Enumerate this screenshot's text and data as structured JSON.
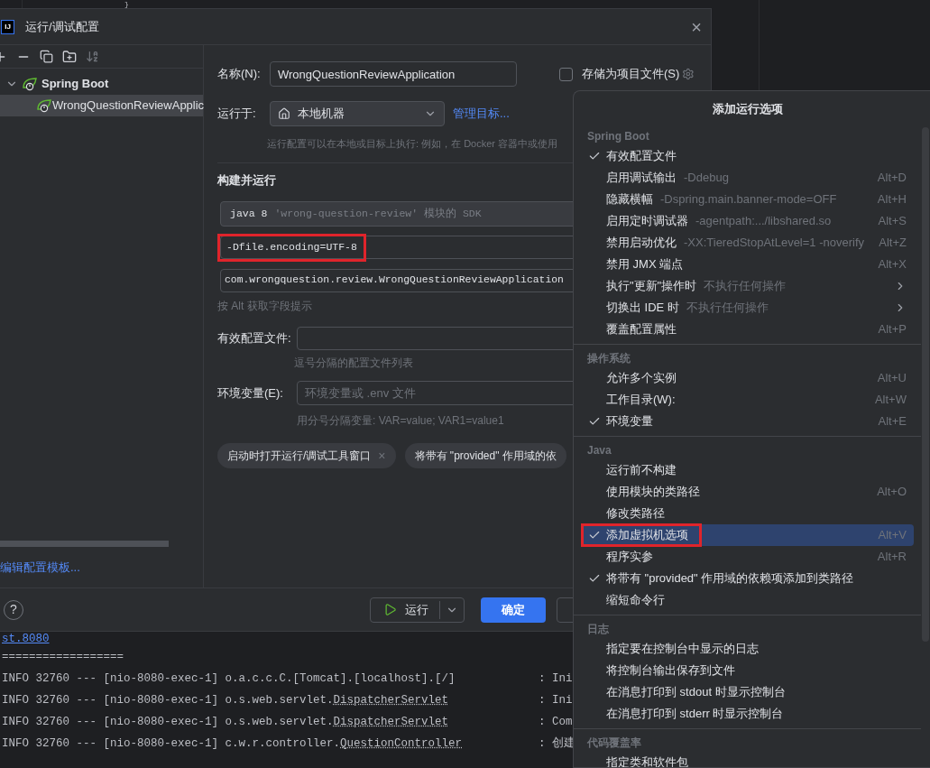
{
  "editor": {
    "brace": "}"
  },
  "dialog": {
    "logo": "IJ",
    "title": "运行/调试配置",
    "close": "×",
    "tree": [
      {
        "label": "Spring Boot",
        "expanded": true,
        "selected": false,
        "children": [
          {
            "label": "WrongQuestionReviewApplic",
            "selected": true
          }
        ]
      }
    ],
    "edit_templates_link": "编辑配置模板...",
    "form": {
      "name_label": "名称(N):",
      "name_value": "WrongQuestionReviewApplication",
      "store_checkbox": {
        "label": "存储为项目文件(S)",
        "checked": false
      },
      "run_on_label": "运行于:",
      "run_on_value": "本地机器",
      "manage_link": "管理目标...",
      "run_on_hint": "运行配置可以在本地或目标上执行: 例如，在 Docker 容器中或使用",
      "section": "构建并运行",
      "sdk": {
        "main": "java 8",
        "detail": "'wrong-question-review' 模块的 SDK"
      },
      "vm_options": {
        "value": "-Dfile.encoding=UTF-8",
        "marked": true
      },
      "main_class": "com.wrongquestion.review.WrongQuestionReviewApplication",
      "alt_hint": "按 Alt 获取字段提示",
      "profiles_label": "有效配置文件:",
      "profiles_hint": "逗号分隔的配置文件列表",
      "env_label": "环境变量(E):",
      "env_placeholder": "环境变量或 .env 文件",
      "env_hint": "用分号分隔变量: VAR=value; VAR1=value1",
      "chips": [
        {
          "label": "启动时打开运行/调试工具窗口",
          "close": "×"
        },
        {
          "label": "将带有 \"provided\" 作用域的依"
        }
      ]
    },
    "footer": {
      "help": "?",
      "run": "运行",
      "ok": "确定"
    }
  },
  "console": {
    "link": "st.8080",
    "rule": "==================",
    "lines": [
      {
        "prefix": "INFO 32760 --- [nio-8080-exec-1] o.a.c.c.C.[Tomcat].[localhost].[/]",
        "message": ": Ini"
      },
      {
        "prefix": "INFO 32760 --- [nio-8080-exec-1] o.s.web.servlet.",
        "cls": "DispatcherServlet",
        "message": ": Ini"
      },
      {
        "prefix": "INFO 32760 --- [nio-8080-exec-1] o.s.web.servlet.",
        "cls": "DispatcherServlet",
        "message": ": Com"
      },
      {
        "prefix": "INFO 32760 --- [nio-8080-exec-1] c.w.r.controller.",
        "cls": "QuestionController",
        "message": ": 创建"
      }
    ]
  },
  "popup": {
    "title": "添加运行选项",
    "sections": [
      {
        "header": "Spring Boot",
        "items": [
          {
            "kind": "option",
            "label": "有效配置文件",
            "checked": true,
            "selected": false,
            "marked": false
          },
          {
            "kind": "option",
            "label": "启用调试输出",
            "hint": "-Ddebug",
            "shortcut": "Alt+D",
            "checked": false,
            "selected": false,
            "marked": false
          },
          {
            "kind": "option",
            "label": "隐藏横幅",
            "hint": "-Dspring.main.banner-mode=OFF",
            "shortcut": "Alt+H",
            "checked": false,
            "selected": false,
            "marked": false
          },
          {
            "kind": "option",
            "label": "启用定时调试器",
            "hint": "-agentpath:.../libshared.so",
            "shortcut": "Alt+S",
            "checked": false,
            "selected": false,
            "marked": false
          },
          {
            "kind": "option",
            "label": "禁用启动优化",
            "hint": "-XX:TieredStopAtLevel=1 -noverify",
            "shortcut": "Alt+Z",
            "checked": false,
            "selected": false,
            "marked": false
          },
          {
            "kind": "option",
            "label": "禁用 JMX 端点",
            "shortcut": "Alt+X",
            "checked": false,
            "selected": false,
            "marked": false
          },
          {
            "kind": "submenu",
            "label": "执行\"更新\"操作时",
            "hint": "不执行任何操作",
            "checked": false,
            "selected": false,
            "marked": false
          },
          {
            "kind": "submenu",
            "label": "切换出 IDE 时",
            "hint": "不执行任何操作",
            "checked": false,
            "selected": false,
            "marked": false
          },
          {
            "kind": "option",
            "label": "覆盖配置属性",
            "shortcut": "Alt+P",
            "checked": false,
            "selected": false,
            "marked": false
          }
        ]
      },
      {
        "header": "操作系统",
        "items": [
          {
            "kind": "option",
            "label": "允许多个实例",
            "shortcut": "Alt+U",
            "checked": false,
            "selected": false,
            "marked": false
          },
          {
            "kind": "option",
            "label": "工作目录(W):",
            "shortcut": "Alt+W",
            "checked": false,
            "selected": false,
            "marked": false
          },
          {
            "kind": "option",
            "label": "环境变量",
            "shortcut": "Alt+E",
            "checked": true,
            "selected": false,
            "marked": false
          }
        ]
      },
      {
        "header": "Java",
        "items": [
          {
            "kind": "option",
            "label": "运行前不构建",
            "checked": false,
            "selected": false,
            "marked": false
          },
          {
            "kind": "option",
            "label": "使用模块的类路径",
            "shortcut": "Alt+O",
            "checked": false,
            "selected": false,
            "marked": false
          },
          {
            "kind": "option",
            "label": "修改类路径",
            "checked": false,
            "selected": false,
            "marked": false
          },
          {
            "kind": "option",
            "label": "添加虚拟机选项",
            "shortcut": "Alt+V",
            "checked": true,
            "selected": true,
            "marked": true
          },
          {
            "kind": "option",
            "label": "程序实参",
            "shortcut": "Alt+R",
            "checked": false,
            "selected": false,
            "marked": false
          },
          {
            "kind": "option",
            "label": "将带有 \"provided\" 作用域的依赖项添加到类路径",
            "checked": true,
            "selected": false,
            "marked": false
          },
          {
            "kind": "option",
            "label": "缩短命令行",
            "checked": false,
            "selected": false,
            "marked": false
          }
        ]
      },
      {
        "header": "日志",
        "items": [
          {
            "kind": "option",
            "label": "指定要在控制台中显示的日志",
            "checked": false,
            "selected": false,
            "marked": false
          },
          {
            "kind": "option",
            "label": "将控制台输出保存到文件",
            "checked": false,
            "selected": false,
            "marked": false
          },
          {
            "kind": "option",
            "label": "在消息打印到 stdout 时显示控制台",
            "checked": false,
            "selected": false,
            "marked": false
          },
          {
            "kind": "option",
            "label": "在消息打印到 stderr 时显示控制台",
            "checked": false,
            "selected": false,
            "marked": false
          }
        ]
      },
      {
        "header": "代码覆盖率",
        "items": [
          {
            "kind": "option",
            "label": "指定类和软件包",
            "checked": false,
            "selected": false,
            "marked": false
          }
        ]
      }
    ]
  }
}
